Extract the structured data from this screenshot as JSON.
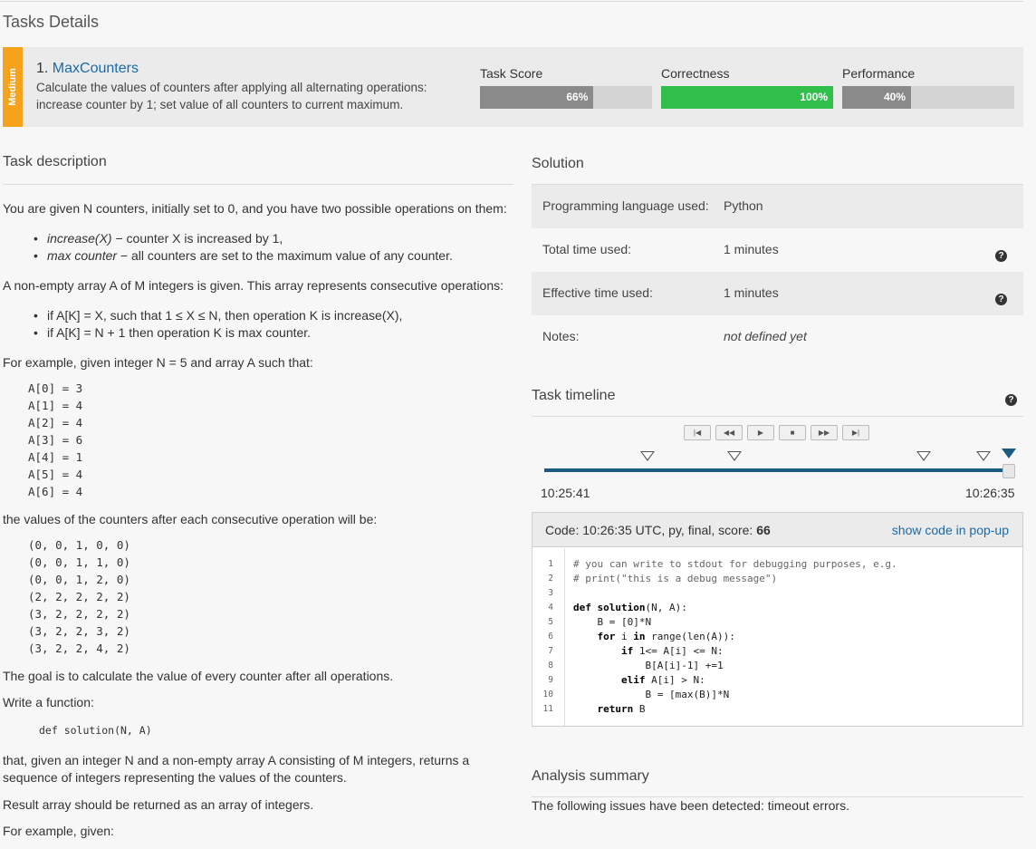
{
  "page_title": "Tasks Details",
  "task": {
    "difficulty": "Medium",
    "number": "1.",
    "name": "MaxCounters",
    "description": "Calculate the values of counters after applying all alternating operations: increase counter by 1; set value of all counters to current maximum."
  },
  "metrics": [
    {
      "label": "Task Score",
      "value": "66%",
      "fraction": 0.66,
      "color": "#8a8a8a"
    },
    {
      "label": "Correctness",
      "value": "100%",
      "fraction": 1.0,
      "color": "#2fbf4a"
    },
    {
      "label": "Performance",
      "value": "40%",
      "fraction": 0.4,
      "color": "#8a8a8a"
    }
  ],
  "description": {
    "heading": "Task description",
    "p1": "You are given N counters, initially set to 0, and you have two possible operations on them:",
    "ops": [
      {
        "name": "increase(X)",
        "text": " − counter X is increased by 1,"
      },
      {
        "name": "max counter",
        "text": " − all counters are set to the maximum value of any counter."
      }
    ],
    "p2": "A non-empty array A of M integers is given. This array represents consecutive operations:",
    "rules": [
      "if A[K] = X, such that 1 ≤ X ≤ N, then operation K is increase(X),",
      "if A[K] = N + 1 then operation K is max counter."
    ],
    "p3": "For example, given integer N = 5 and array A such that:",
    "array": "A[0] = 3\nA[1] = 4\nA[2] = 4\nA[3] = 6\nA[4] = 1\nA[5] = 4\nA[6] = 4",
    "p4": "the values of the counters after each consecutive operation will be:",
    "states": "(0, 0, 1, 0, 0)\n(0, 0, 1, 1, 0)\n(0, 0, 1, 2, 0)\n(2, 2, 2, 2, 2)\n(3, 2, 2, 2, 2)\n(3, 2, 2, 3, 2)\n(3, 2, 2, 4, 2)",
    "p5": "The goal is to calculate the value of every counter after all operations.",
    "p6": "Write a function:",
    "signature": "def solution(N, A)",
    "p7": "that, given an integer N and a non-empty array A consisting of M integers, returns a sequence of integers representing the values of the counters.",
    "p8": "Result array should be returned as an array of integers.",
    "p9": "For example, given:"
  },
  "solution": {
    "heading": "Solution",
    "rows": [
      {
        "key": "Programming language used:",
        "value": "Python"
      },
      {
        "key": "Total time used:",
        "value": "1 minutes"
      },
      {
        "key": "Effective time used:",
        "value": "1 minutes"
      },
      {
        "key": "Notes:",
        "value": "not defined yet"
      }
    ]
  },
  "timeline": {
    "heading": "Task timeline",
    "controls": [
      "|◀",
      "◀◀",
      "▶",
      "■",
      "▶▶",
      "▶|"
    ],
    "start_time": "10:25:41",
    "end_time": "10:26:35"
  },
  "code": {
    "label": "Code: 10:26:35 UTC, py, final, score:",
    "score": "66",
    "popup_link": "show code in pop-up",
    "line_numbers": [
      "1",
      "2",
      "3",
      "4",
      "5",
      "6",
      "7",
      "8",
      "9",
      "10",
      "11"
    ]
  },
  "analysis": {
    "heading": "Analysis summary",
    "text": "The following issues have been detected: timeout errors."
  }
}
